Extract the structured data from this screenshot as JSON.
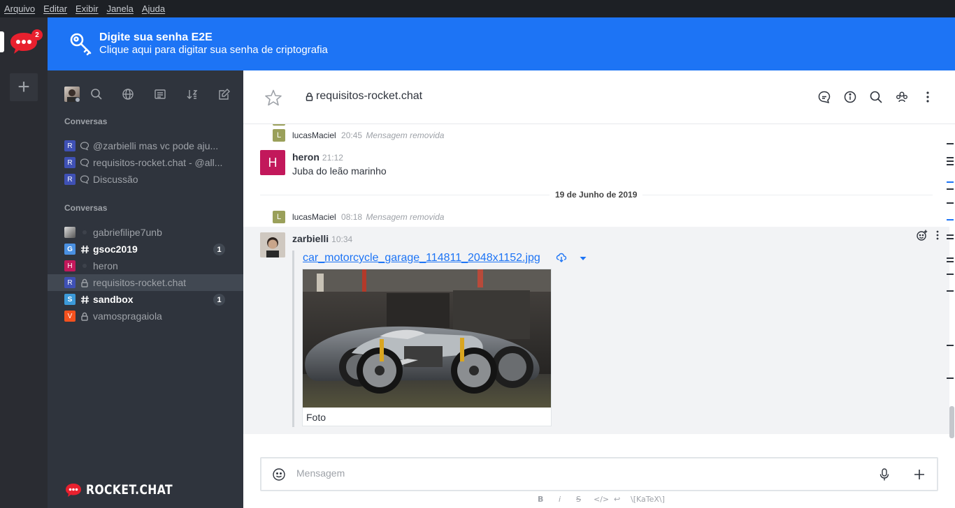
{
  "menubar": {
    "items": [
      "Arquivo",
      "Editar",
      "Exibir",
      "Janela",
      "Ajuda"
    ]
  },
  "rail": {
    "badge_count": "2",
    "add_label": "+"
  },
  "banner": {
    "title": "Digite sua senha E2E",
    "subtitle": "Clique aqui para digitar sua senha de criptografia"
  },
  "sidebar": {
    "section_discussions": "Conversas",
    "discussions": [
      {
        "avatar_letter": "R",
        "avatar_color": "#3f51b5",
        "name": "@zarbielli mas vc pode aju..."
      },
      {
        "avatar_letter": "R",
        "avatar_color": "#3f51b5",
        "name": "requisitos-rocket.chat - @all..."
      },
      {
        "avatar_letter": "R",
        "avatar_color": "#3f51b5",
        "name": "Discussão"
      }
    ],
    "section_conversations": "Conversas",
    "rooms": [
      {
        "avatar_letter": "",
        "avatar_color": "#888888",
        "name": "gabriefilipe7unb",
        "type": "direct",
        "unread": ""
      },
      {
        "avatar_letter": "G",
        "avatar_color": "#4a90e2",
        "name": "gsoc2019",
        "type": "channel",
        "unread": "1"
      },
      {
        "avatar_letter": "H",
        "avatar_color": "#c2185b",
        "name": "heron",
        "type": "direct",
        "unread": ""
      },
      {
        "avatar_letter": "R",
        "avatar_color": "#3f51b5",
        "name": "requisitos-rocket.chat",
        "type": "private",
        "unread": ""
      },
      {
        "avatar_letter": "S",
        "avatar_color": "#3c9ad9",
        "name": "sandbox",
        "type": "channel",
        "unread": "1"
      },
      {
        "avatar_letter": "V",
        "avatar_color": "#f4511e",
        "name": "vamospragaiola",
        "type": "private",
        "unread": ""
      }
    ],
    "footer_logo_text": "ROCKET.CHAT"
  },
  "header": {
    "room_title": "requisitos-rocket.chat"
  },
  "messages": {
    "removed1": {
      "avatar_letter": "L",
      "user": "lucasMaciel",
      "time": "20:45",
      "text": "Mensagem removida"
    },
    "heron": {
      "avatar_letter": "H",
      "avatar_color": "#c2185b",
      "user": "heron",
      "time": "21:12",
      "text": "Juba do leão marinho"
    },
    "day_divider": "19 de Junho de 2019",
    "removed2": {
      "avatar_letter": "L",
      "user": "lucasMaciel",
      "time": "08:18",
      "text": "Mensagem removida"
    },
    "zarbielli": {
      "user": "zarbielli",
      "time": "10:34",
      "attachment_title": "car_motorcycle_garage_114811_2048x1152.jpg",
      "caption": "Foto"
    }
  },
  "composer": {
    "placeholder": "Mensagem"
  },
  "format_bar": {
    "bold": "B",
    "italic": "i",
    "strike": "S",
    "code": "</>",
    "multiline": "↩",
    "katex": "\\[KaTeX\\]"
  },
  "colors": {
    "accent": "#1d74f5",
    "sidebar_bg": "#2f343d",
    "rail_bg": "#2a2c32",
    "badge_red": "#e8202e"
  }
}
